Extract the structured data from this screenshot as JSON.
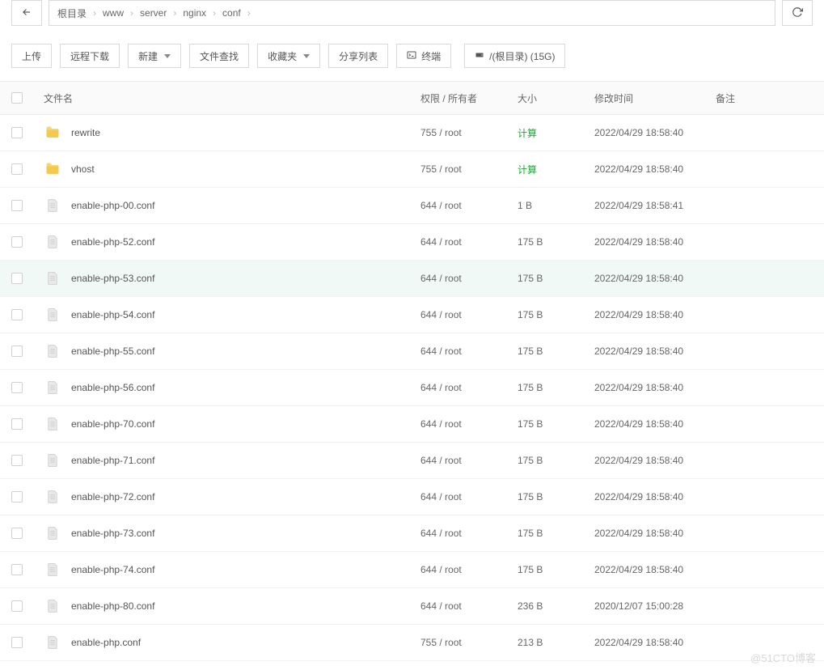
{
  "breadcrumb": [
    "根目录",
    "www",
    "server",
    "nginx",
    "conf"
  ],
  "toolbar": {
    "upload": "上传",
    "remote_download": "远程下载",
    "new": "新建",
    "file_search": "文件查找",
    "favorites": "收藏夹",
    "share_list": "分享列表",
    "terminal": "终端",
    "disk": "/(根目录) (15G)"
  },
  "headers": {
    "filename": "文件名",
    "permission": "权限 / 所有者",
    "size": "大小",
    "mtime": "修改时间",
    "note": "备注"
  },
  "size_calc_label": "计算",
  "files": [
    {
      "name": "rewrite",
      "type": "folder",
      "perm": "755 / root",
      "size": "",
      "size_is_calc": true,
      "mtime": "2022/04/29 18:58:40"
    },
    {
      "name": "vhost",
      "type": "folder",
      "perm": "755 / root",
      "size": "",
      "size_is_calc": true,
      "mtime": "2022/04/29 18:58:40"
    },
    {
      "name": "enable-php-00.conf",
      "type": "file",
      "perm": "644 / root",
      "size": "1 B",
      "size_is_calc": false,
      "mtime": "2022/04/29 18:58:41"
    },
    {
      "name": "enable-php-52.conf",
      "type": "file",
      "perm": "644 / root",
      "size": "175 B",
      "size_is_calc": false,
      "mtime": "2022/04/29 18:58:40"
    },
    {
      "name": "enable-php-53.conf",
      "type": "file",
      "perm": "644 / root",
      "size": "175 B",
      "size_is_calc": false,
      "mtime": "2022/04/29 18:58:40",
      "hovered": true
    },
    {
      "name": "enable-php-54.conf",
      "type": "file",
      "perm": "644 / root",
      "size": "175 B",
      "size_is_calc": false,
      "mtime": "2022/04/29 18:58:40"
    },
    {
      "name": "enable-php-55.conf",
      "type": "file",
      "perm": "644 / root",
      "size": "175 B",
      "size_is_calc": false,
      "mtime": "2022/04/29 18:58:40"
    },
    {
      "name": "enable-php-56.conf",
      "type": "file",
      "perm": "644 / root",
      "size": "175 B",
      "size_is_calc": false,
      "mtime": "2022/04/29 18:58:40"
    },
    {
      "name": "enable-php-70.conf",
      "type": "file",
      "perm": "644 / root",
      "size": "175 B",
      "size_is_calc": false,
      "mtime": "2022/04/29 18:58:40"
    },
    {
      "name": "enable-php-71.conf",
      "type": "file",
      "perm": "644 / root",
      "size": "175 B",
      "size_is_calc": false,
      "mtime": "2022/04/29 18:58:40"
    },
    {
      "name": "enable-php-72.conf",
      "type": "file",
      "perm": "644 / root",
      "size": "175 B",
      "size_is_calc": false,
      "mtime": "2022/04/29 18:58:40"
    },
    {
      "name": "enable-php-73.conf",
      "type": "file",
      "perm": "644 / root",
      "size": "175 B",
      "size_is_calc": false,
      "mtime": "2022/04/29 18:58:40"
    },
    {
      "name": "enable-php-74.conf",
      "type": "file",
      "perm": "644 / root",
      "size": "175 B",
      "size_is_calc": false,
      "mtime": "2022/04/29 18:58:40"
    },
    {
      "name": "enable-php-80.conf",
      "type": "file",
      "perm": "644 / root",
      "size": "236 B",
      "size_is_calc": false,
      "mtime": "2020/12/07 15:00:28"
    },
    {
      "name": "enable-php.conf",
      "type": "file",
      "perm": "755 / root",
      "size": "213 B",
      "size_is_calc": false,
      "mtime": "2022/04/29 18:58:40"
    }
  ],
  "watermark": "@51CTO博客"
}
